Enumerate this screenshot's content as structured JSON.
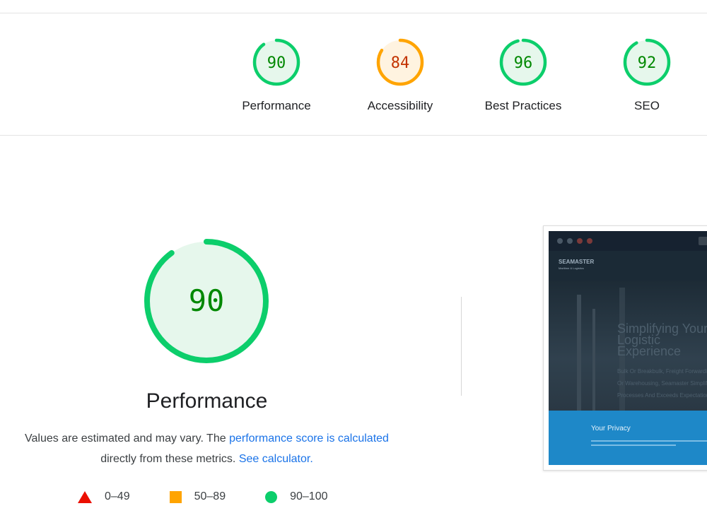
{
  "colors": {
    "pass": "#0cce6b",
    "pass_text": "#008800",
    "average": "#ffa400",
    "average_text": "#c33300",
    "fail": "#eb0f00",
    "link": "#1a73e8"
  },
  "gauges": [
    {
      "label": "Performance",
      "score": 90,
      "status": "pass"
    },
    {
      "label": "Accessibility",
      "score": 84,
      "status": "average"
    },
    {
      "label": "Best Practices",
      "score": 96,
      "status": "pass"
    },
    {
      "label": "SEO",
      "score": 92,
      "status": "pass"
    }
  ],
  "main": {
    "score": 90,
    "title": "Performance",
    "desc_pre": "Values are estimated and may vary. The ",
    "desc_link1": "performance score is calculated",
    "desc_mid": " directly from these metrics. ",
    "desc_link2": "See calculator."
  },
  "legend": [
    {
      "shape": "triangle-icon",
      "range": "0–49"
    },
    {
      "shape": "square-icon",
      "range": "50–89"
    },
    {
      "shape": "circle-icon",
      "range": "90–100"
    }
  ],
  "screenshot": {
    "logo": "SEAMASTER",
    "logo_sub": "Maritime & Logistics",
    "hero_title": "Simplifying Your Logistic Experience",
    "hero_sub": "Bulk Or Breakbulk, Freight Forwarding Or Warehousing, Seamaster Simplifies Processes And Exceeds Expectations!",
    "privacy_title": "Your Privacy"
  }
}
